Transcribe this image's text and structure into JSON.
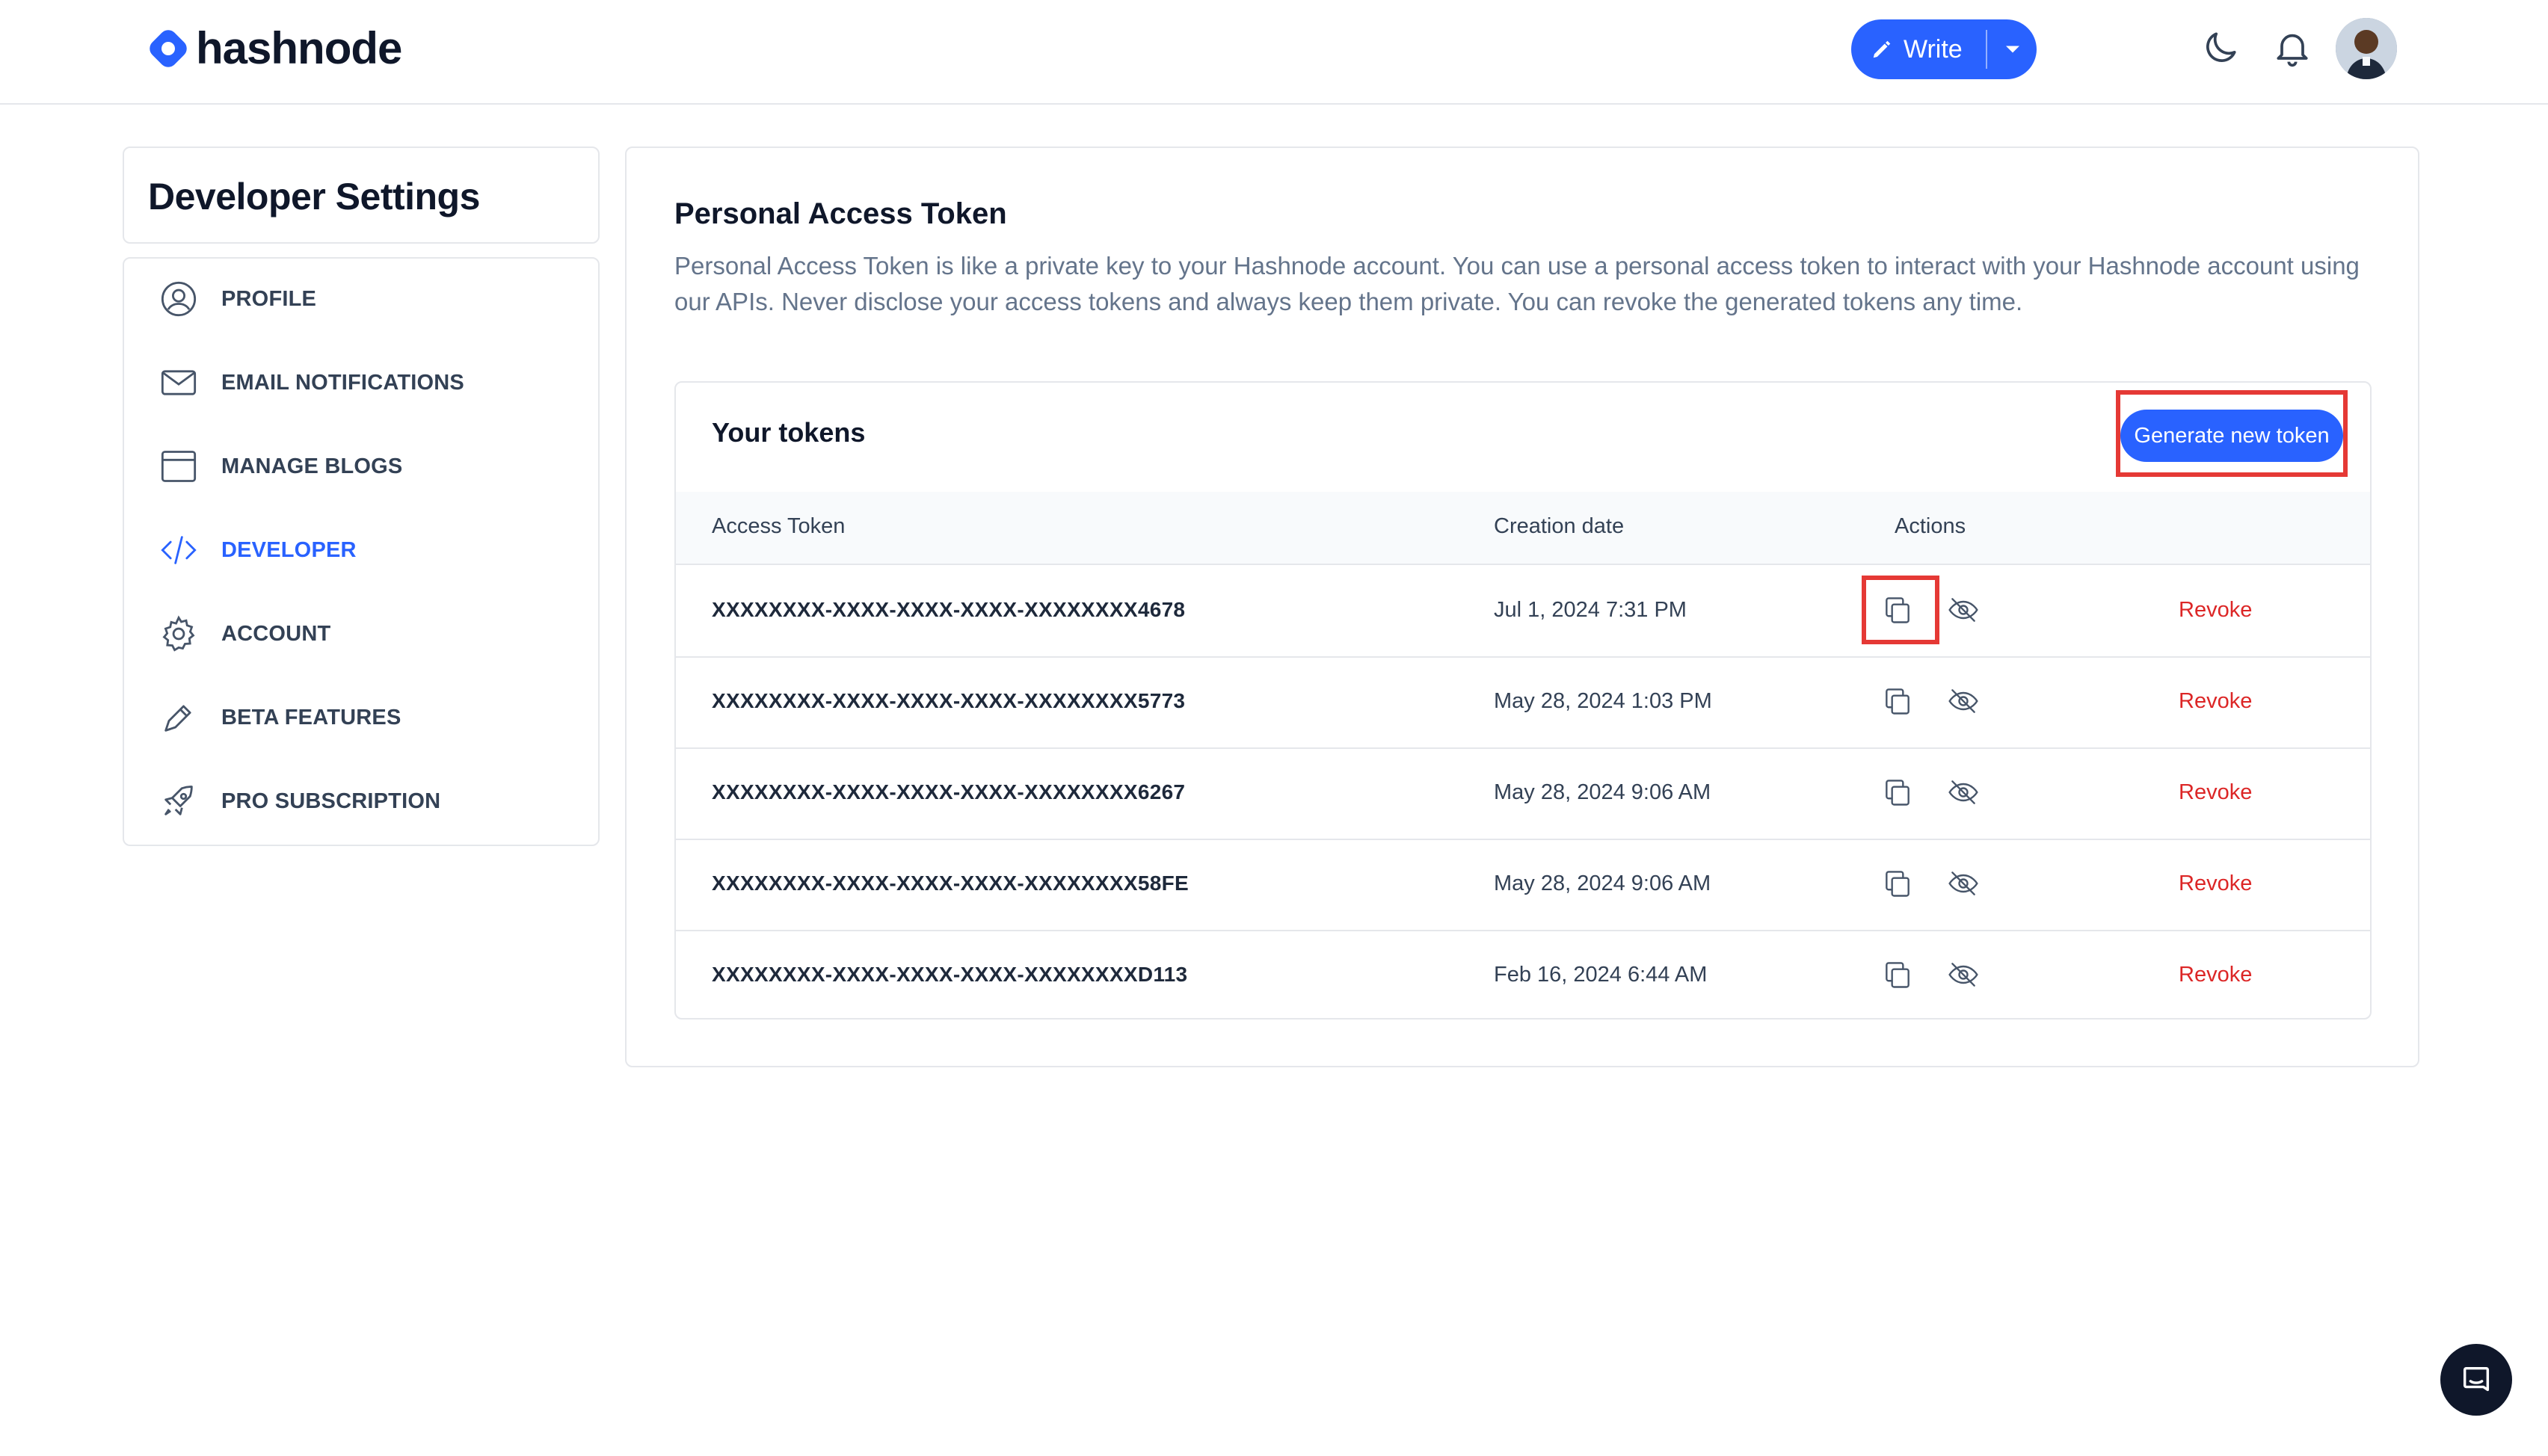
{
  "header": {
    "logo_text": "hashnode",
    "write_label": "Write",
    "brand_color": "#2962ff",
    "icons": [
      "moon-icon",
      "bell-icon",
      "avatar"
    ]
  },
  "sidebar": {
    "title": "Developer Settings",
    "items": [
      {
        "label": "PROFILE",
        "icon": "user-circle-icon"
      },
      {
        "label": "EMAIL NOTIFICATIONS",
        "icon": "mail-icon"
      },
      {
        "label": "MANAGE BLOGS",
        "icon": "browser-window-icon"
      },
      {
        "label": "DEVELOPER",
        "icon": "code-icon",
        "active": true
      },
      {
        "label": "ACCOUNT",
        "icon": "gear-icon"
      },
      {
        "label": "BETA FEATURES",
        "icon": "pen-icon"
      },
      {
        "label": "PRO SUBSCRIPTION",
        "icon": "rocket-icon"
      }
    ]
  },
  "main": {
    "title": "Personal Access Token",
    "description": "Personal Access Token is like a private key to your Hashnode account. You can use a personal access token to interact with your Hashnode account using our APIs. Never disclose your access tokens and always keep them private. You can revoke the generated tokens any time.",
    "tokens": {
      "title": "Your tokens",
      "generate_label": "Generate new token",
      "columns": [
        "Access Token",
        "Creation date",
        "Actions"
      ],
      "rows": [
        {
          "token": "XXXXXXXX-XXXX-XXXX-XXXX-XXXXXXXX4678",
          "date": "Jul 1, 2024 7:31 PM",
          "revoke": "Revoke"
        },
        {
          "token": "XXXXXXXX-XXXX-XXXX-XXXX-XXXXXXXX5773",
          "date": "May 28, 2024 1:03 PM",
          "revoke": "Revoke"
        },
        {
          "token": "XXXXXXXX-XXXX-XXXX-XXXX-XXXXXXXX6267",
          "date": "May 28, 2024 9:06 AM",
          "revoke": "Revoke"
        },
        {
          "token": "XXXXXXXX-XXXX-XXXX-XXXX-XXXXXXXX58FE",
          "date": "May 28, 2024 9:06 AM",
          "revoke": "Revoke"
        },
        {
          "token": "XXXXXXXX-XXXX-XXXX-XXXX-XXXXXXXXD113",
          "date": "Feb 16, 2024 6:44 AM",
          "revoke": "Revoke"
        }
      ]
    }
  },
  "colors": {
    "accent": "#2962ff",
    "revoke": "#dc2626",
    "highlight": "#e53935"
  }
}
